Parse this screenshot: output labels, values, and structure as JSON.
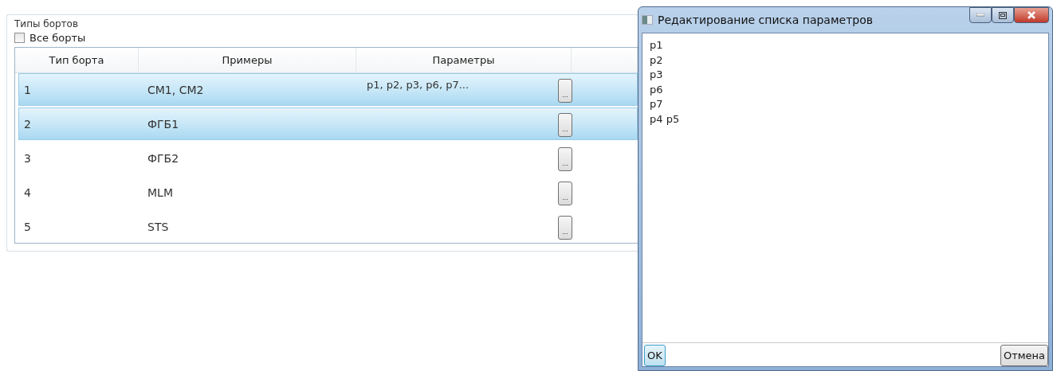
{
  "group": {
    "title": "Типы бортов",
    "all_checkbox": {
      "label": "Все борты",
      "checked": false
    },
    "table": {
      "columns": [
        "Тип борта",
        "Примеры",
        "Параметры"
      ],
      "rows": [
        {
          "type": "1",
          "examples": "СМ1, СМ2",
          "params": "p1, p2, p3, p6, p7...",
          "selected": true
        },
        {
          "type": "2",
          "examples": "ФГБ1",
          "params": "",
          "selected": true
        },
        {
          "type": "3",
          "examples": "ФГБ2",
          "params": "",
          "selected": false
        },
        {
          "type": "4",
          "examples": "MLM",
          "params": "",
          "selected": false
        },
        {
          "type": "5",
          "examples": "STS",
          "params": "",
          "selected": false
        }
      ],
      "row_button": "..."
    }
  },
  "dialog": {
    "title": "Редактирование списка параметров",
    "lines": [
      "p1",
      "p2",
      "p3",
      "p6",
      "p7",
      "p4 p5"
    ],
    "ok": "OK",
    "cancel": "Отмена"
  }
}
